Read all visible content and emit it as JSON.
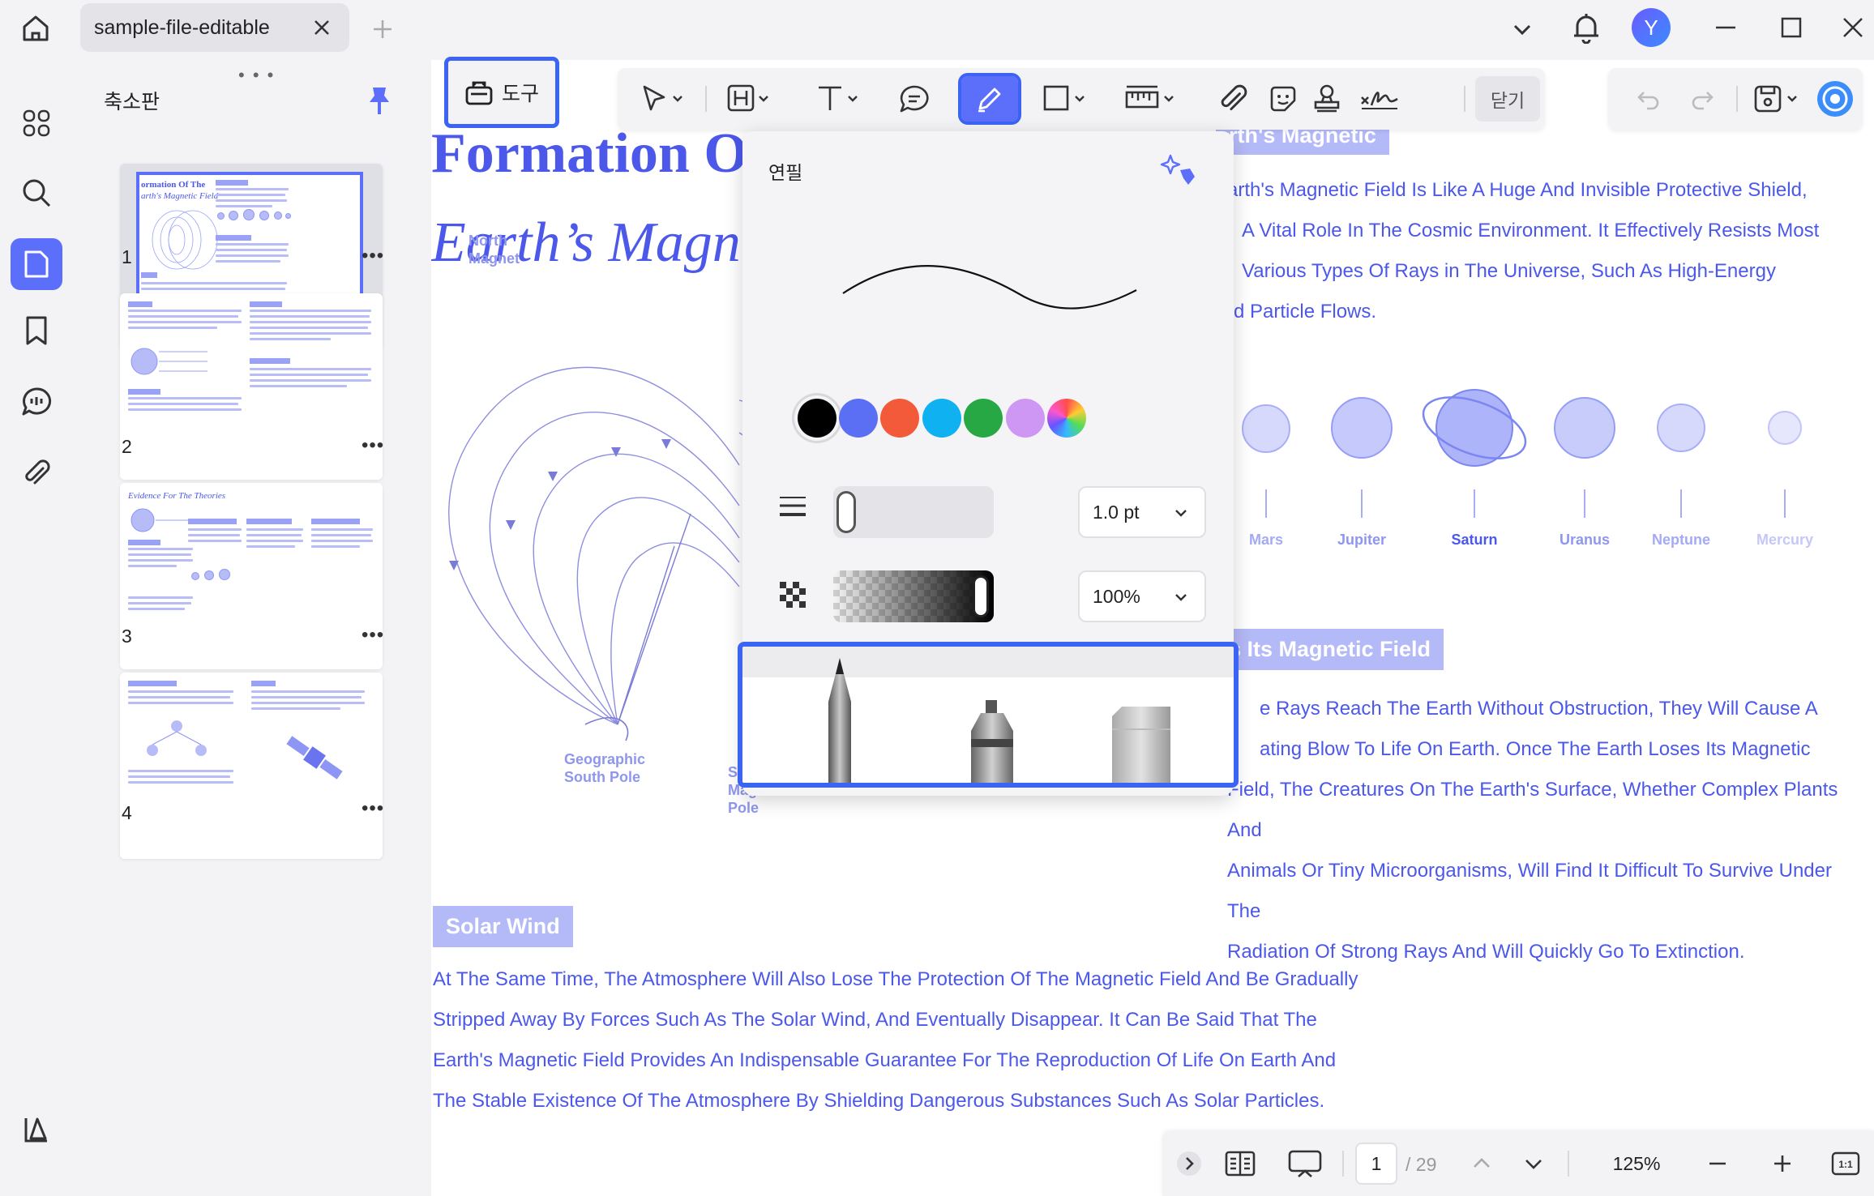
{
  "titlebar": {
    "tab_title": "sample-file-editable",
    "avatar_initial": "Y"
  },
  "sidebar": {
    "panel_title": "축소판",
    "drag_handle": "• • •",
    "thumbnails": [
      {
        "page": "1",
        "more": "•••",
        "current": true
      },
      {
        "page": "2",
        "more": "•••"
      },
      {
        "page": "3",
        "more": "•••",
        "title": "Evidence For The Theories"
      },
      {
        "page": "4",
        "more": "•••"
      }
    ],
    "thumb1_title_line1": "ormation Of The",
    "thumb1_title_line2": "arth's Magnetic Field",
    "rail_icons": [
      "grid-icon",
      "search-icon",
      "page-icon",
      "bookmark-icon",
      "comment-icon",
      "attachment-icon",
      "layers-icon"
    ]
  },
  "toolbar": {
    "tools_label": "도구",
    "close_label": "닫기",
    "tools": [
      "select-arrow-icon",
      "heading-icon",
      "text-icon",
      "comment-bubble-icon",
      "pencil-icon",
      "rectangle-icon",
      "measure-icon",
      "attachment-icon",
      "sticker-icon",
      "stamp-icon",
      "signature-icon"
    ]
  },
  "pencil_panel": {
    "title": "연필",
    "colors": [
      "#000000",
      "#5b6ff5",
      "#f25a3a",
      "#10b1f0",
      "#27a844",
      "#cf97f4",
      "rainbow"
    ],
    "selected_color": "#000000",
    "thickness": "1.0 pt",
    "opacity": "100%",
    "tool_types": [
      "pencil",
      "marker",
      "eraser"
    ]
  },
  "document": {
    "title_line1": "Formation O",
    "title_line2": "Earth’s Magn",
    "magnetic_tag": "rth's Magnetic",
    "para1": [
      "arth's Magnetic Field Is Like A Huge And Invisible Protective Shield,",
      "A Vital Role In The Cosmic Environment. It Effectively Resists Most",
      "Various Types Of Rays in The Universe, Such As High-Energy",
      "d Particle Flows."
    ],
    "planets": [
      "Mars",
      "Jupiter",
      "Saturn",
      "Uranus",
      "Neptune",
      "Mercury"
    ],
    "diagram_labels": {
      "north_line1": "North",
      "north_line2": "Magnet",
      "geo_south_line1": "Geographic",
      "geo_south_line2": "South Pole",
      "mag_pole_line1": "S",
      "mag_pole_line2": "Magnetic",
      "mag_pole_line3": "Pole"
    },
    "section2_tag": "s Its Magnetic Field",
    "para2": [
      "e Rays Reach The Earth Without Obstruction, They Will Cause A",
      "ating Blow To Life On Earth. Once The Earth Loses Its Magnetic",
      "Field, The Creatures On The Earth's Surface, Whether Complex Plants And",
      "Animals Or Tiny Microorganisms, Will Find It Difficult To Survive Under The",
      "Radiation Of Strong Rays And Will Quickly Go To Extinction."
    ],
    "solar_tag": "Solar Wind",
    "para3": [
      "At The Same Time, The Atmosphere Will Also Lose The Protection Of The Magnetic Field And Be Gradually",
      "Stripped Away By Forces Such As The Solar Wind, And Eventually Disappear. It Can Be Said That The",
      "Earth's Magnetic Field Provides An Indispensable Guarantee For The Reproduction Of Life On Earth And",
      "The Stable Existence Of The Atmosphere By Shielding Dangerous Substances Such As Solar Particles."
    ]
  },
  "status_bar": {
    "current_page": "1",
    "total_pages": "/ 29",
    "zoom": "125%"
  }
}
